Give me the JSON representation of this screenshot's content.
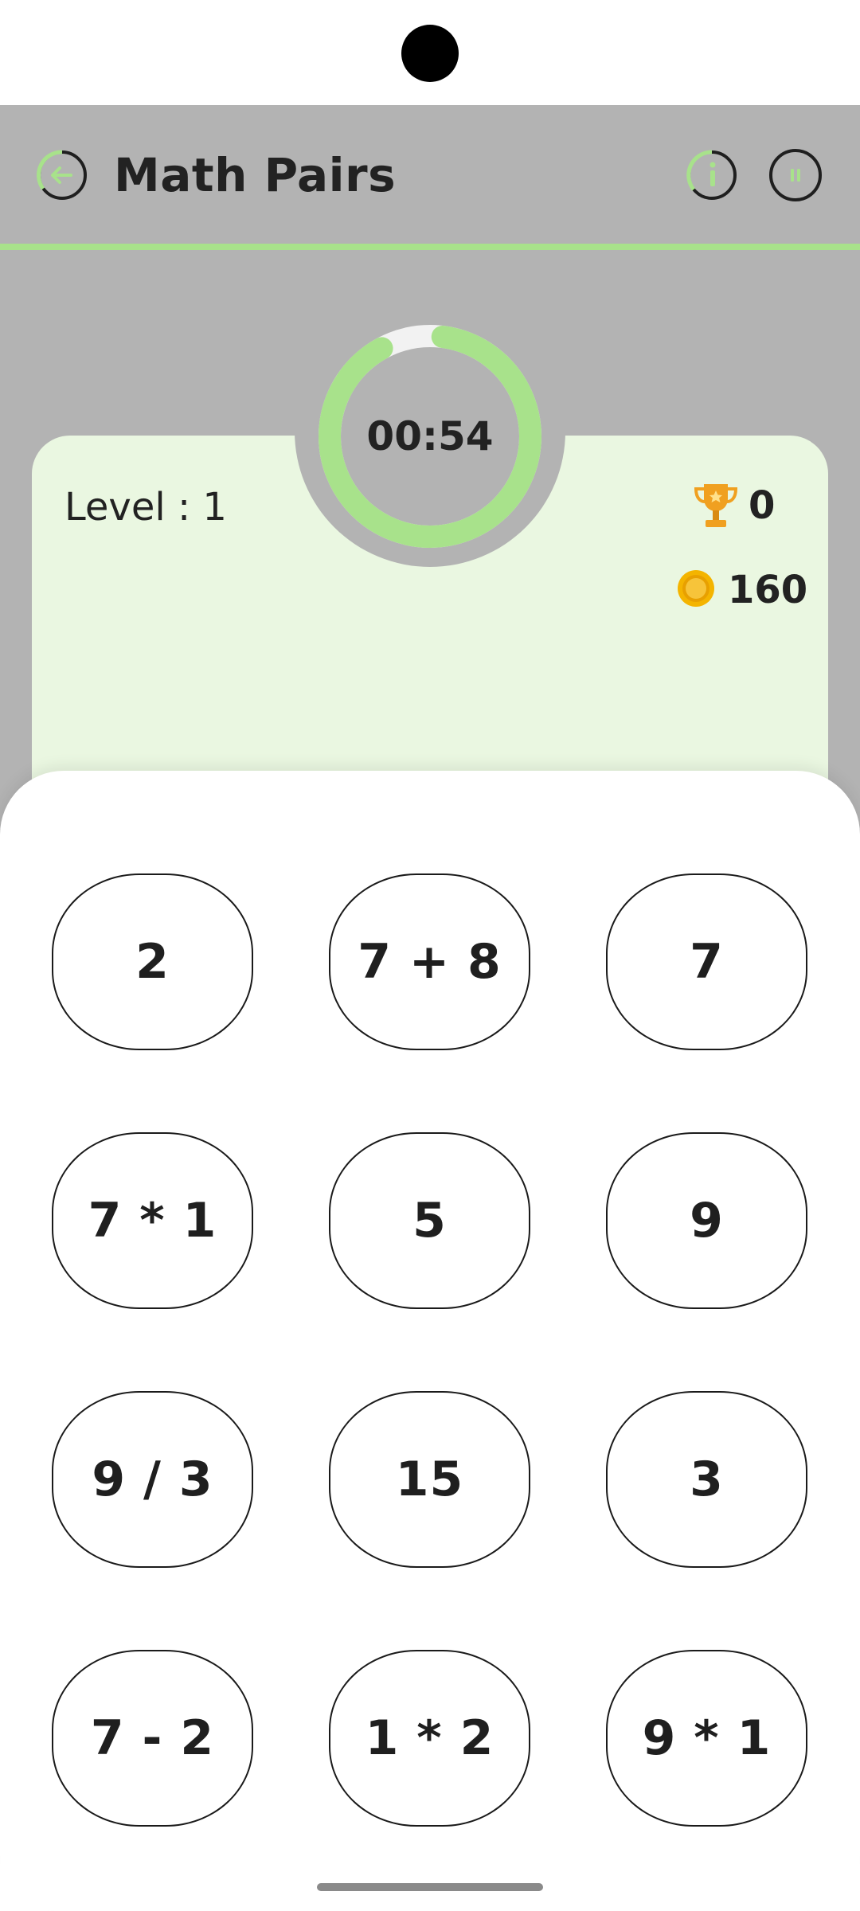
{
  "app": {
    "title": "Math Pairs"
  },
  "colors": {
    "accent": "#a8e28b",
    "header_bg": "#b3b3b3",
    "card_bg": "#eaf7e1",
    "coin": "#f4b400",
    "trophy": "#f0a020"
  },
  "icons": {
    "back": "back-arrow-icon",
    "info": "info-icon",
    "pause": "pause-icon",
    "trophy": "trophy-icon",
    "coin": "coin-icon"
  },
  "timer": {
    "text": "00:54",
    "progress": 0.9
  },
  "stats": {
    "level_label": "Level : 1",
    "trophies": "0",
    "coins": "160"
  },
  "tiles": [
    "2",
    "7 + 8",
    "7",
    "7 * 1",
    "5",
    "9",
    "9 / 3",
    "15",
    "3",
    "7 - 2",
    "1 * 2",
    "9 * 1"
  ]
}
